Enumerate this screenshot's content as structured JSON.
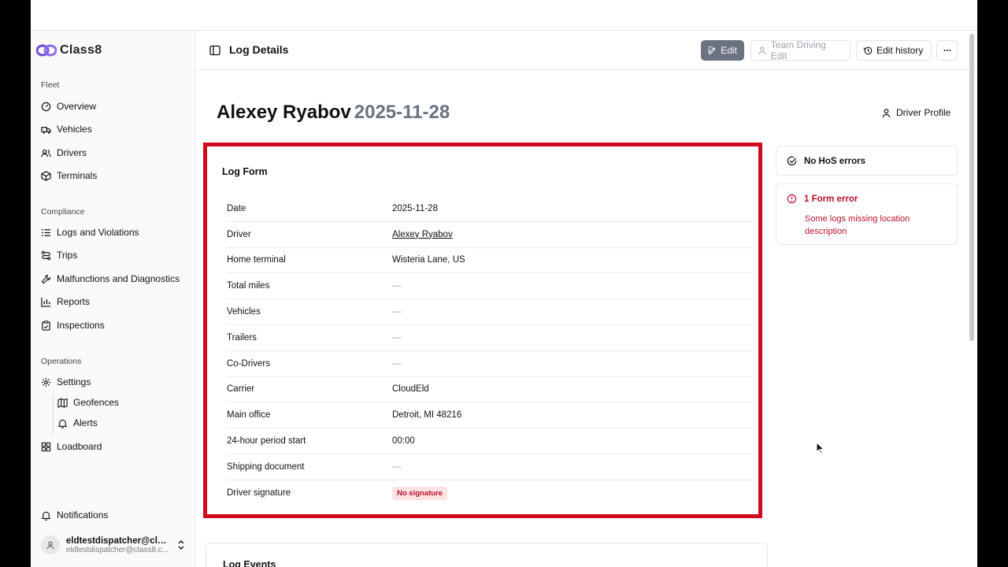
{
  "brand": {
    "name": "Class8"
  },
  "sidebar": {
    "fleet_label": "Fleet",
    "fleet": [
      {
        "label": "Overview",
        "icon": "gauge-icon"
      },
      {
        "label": "Vehicles",
        "icon": "truck-icon"
      },
      {
        "label": "Drivers",
        "icon": "users-icon"
      },
      {
        "label": "Terminals",
        "icon": "package-icon"
      }
    ],
    "compliance_label": "Compliance",
    "compliance": [
      {
        "label": "Logs and Violations",
        "icon": "list-icon"
      },
      {
        "label": "Trips",
        "icon": "route-icon"
      },
      {
        "label": "Malfunctions and Diagnostics",
        "icon": "wrench-icon"
      },
      {
        "label": "Reports",
        "icon": "bar-chart-icon"
      },
      {
        "label": "Inspections",
        "icon": "clipboard-icon"
      }
    ],
    "operations_label": "Operations",
    "operations": [
      {
        "label": "Settings",
        "icon": "gear-icon"
      },
      {
        "label": "Geofences",
        "icon": "map-icon"
      },
      {
        "label": "Alerts",
        "icon": "bell-icon"
      },
      {
        "label": "Loadboard",
        "icon": "grid-icon"
      }
    ],
    "notifications": "Notifications",
    "user": {
      "name": "eldtestdispatcher@cla...",
      "email": "eldtestdispatcher@class8.c..."
    }
  },
  "header": {
    "title": "Log Details",
    "edit": "Edit",
    "team_driving_edit": "Team Driving Edit",
    "edit_history": "Edit history"
  },
  "page": {
    "driver_name": "Alexey Ryabov",
    "date": "2025-11-28",
    "driver_profile": "Driver Profile"
  },
  "log_form": {
    "title": "Log Form",
    "rows": [
      {
        "label": "Date",
        "value": "2025-11-28"
      },
      {
        "label": "Driver",
        "value": "Alexey Ryabov"
      },
      {
        "label": "Home terminal",
        "value": "Wisteria Lane, US"
      },
      {
        "label": "Total miles",
        "value": "—"
      },
      {
        "label": "Vehicles",
        "value": "—"
      },
      {
        "label": "Trailers",
        "value": "—"
      },
      {
        "label": "Co-Drivers",
        "value": "—"
      },
      {
        "label": "Carrier",
        "value": "CloudEld"
      },
      {
        "label": "Main office",
        "value": "Detroit, MI 48216"
      },
      {
        "label": "24-hour period start",
        "value": "00:00"
      },
      {
        "label": "Shipping document",
        "value": "—"
      },
      {
        "label": "Driver signature",
        "value": "No signature"
      }
    ]
  },
  "status": {
    "hos": "No HoS errors",
    "form_error_title": "1 Form error",
    "form_error_desc": "Some logs missing location description"
  },
  "log_events": {
    "title": "Log Events"
  },
  "colors": {
    "accent_red": "#d10a1f",
    "error_text": "#b4122a",
    "edit_btn": "#6b7280"
  }
}
